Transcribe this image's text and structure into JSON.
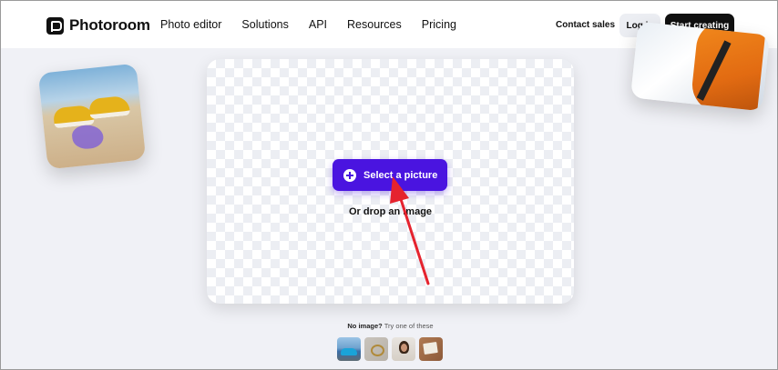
{
  "header": {
    "brand": "Photoroom",
    "nav": [
      "Photo editor",
      "Solutions",
      "API",
      "Resources",
      "Pricing"
    ],
    "contact_label": "Contact sales",
    "login_label": "Log in",
    "cta_label": "Start creating"
  },
  "upload": {
    "button_label": "Select a picture",
    "drop_text": "Or drop an image"
  },
  "samples": {
    "prompt_bold": "No image?",
    "prompt_rest": "Try one of these",
    "thumbnails": [
      "car-thumbnail",
      "ring-thumbnail",
      "woman-thumbnail",
      "desk-thumbnail"
    ]
  },
  "colors": {
    "accent": "#4a14e0",
    "annotation_arrow": "#e5232e",
    "background": "#f0f1f6"
  }
}
